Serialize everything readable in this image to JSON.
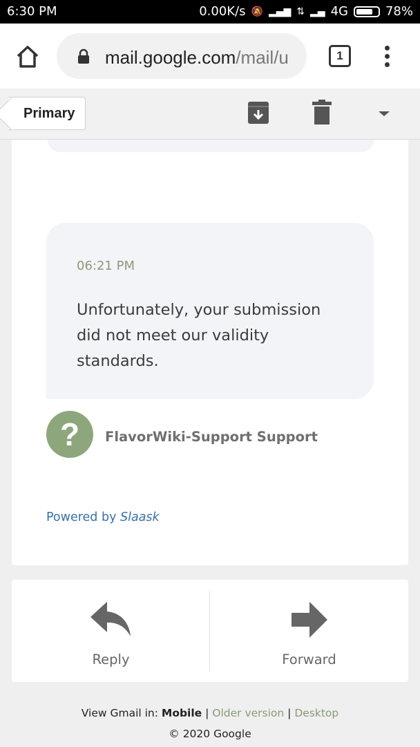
{
  "status_bar": {
    "time": "6:30 PM",
    "network_speed": "0.00K/s",
    "network_type": "4G",
    "battery": "78%",
    "battery_level": 0.78
  },
  "browser": {
    "url_host": "mail.google.com",
    "url_path": "/mail/u",
    "tab_count": "1"
  },
  "toolbar": {
    "primary_label": "Primary"
  },
  "message": {
    "time": "06:21 PM",
    "text": "Unfortunately, your submission did not meet our validity standards.",
    "avatar_symbol": "?",
    "sender": "FlavorWiki-Support Support",
    "powered_prefix": "Powered by ",
    "powered_brand": "Slaask"
  },
  "actions": {
    "reply": "Reply",
    "forward": "Forward"
  },
  "footer": {
    "view_in": "View Gmail in: ",
    "mobile": "Mobile",
    "sep1": " | ",
    "older": "Older version",
    "sep2": " | ",
    "desktop": "Desktop",
    "copyright": "© 2020 Google"
  },
  "colors": {
    "avatar": "#8ea67c",
    "time_text": "#8a9a77",
    "link": "#3b6fa8",
    "bubble": "#f3f4f8"
  }
}
